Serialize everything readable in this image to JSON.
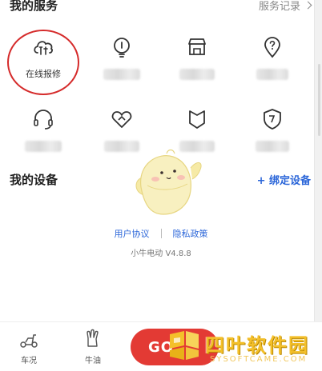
{
  "services": {
    "title": "我的服务",
    "record_link": "服务记录",
    "items": [
      {
        "label": "在线报修",
        "icon": "cloud-tools-icon"
      },
      {
        "label": "",
        "icon": "lightbulb-icon"
      },
      {
        "label": "",
        "icon": "store-icon"
      },
      {
        "label": "",
        "icon": "location-question-icon"
      },
      {
        "label": "",
        "icon": "headset-icon"
      },
      {
        "label": "",
        "icon": "heart-shield-icon"
      },
      {
        "label": "",
        "icon": "badge-icon"
      },
      {
        "label": "",
        "icon": "shield-icon"
      }
    ]
  },
  "devices": {
    "title": "我的设备",
    "bind_link": "+ 绑定设备"
  },
  "footer": {
    "user_agreement": "用户协议",
    "privacy_policy": "隐私政策",
    "version": "小牛电动 V4.8.8"
  },
  "tabbar": {
    "tab1": "车况",
    "tab2": "牛油",
    "go": "GO"
  },
  "watermark": {
    "text": "四叶软件园",
    "url": "SYSOFTCAME.COM"
  },
  "colors": {
    "accent_blue": "#2b66d9",
    "go_red": "#e33a34",
    "annotation_red": "#d52b2b",
    "watermark_gold": "#f4c02a"
  }
}
